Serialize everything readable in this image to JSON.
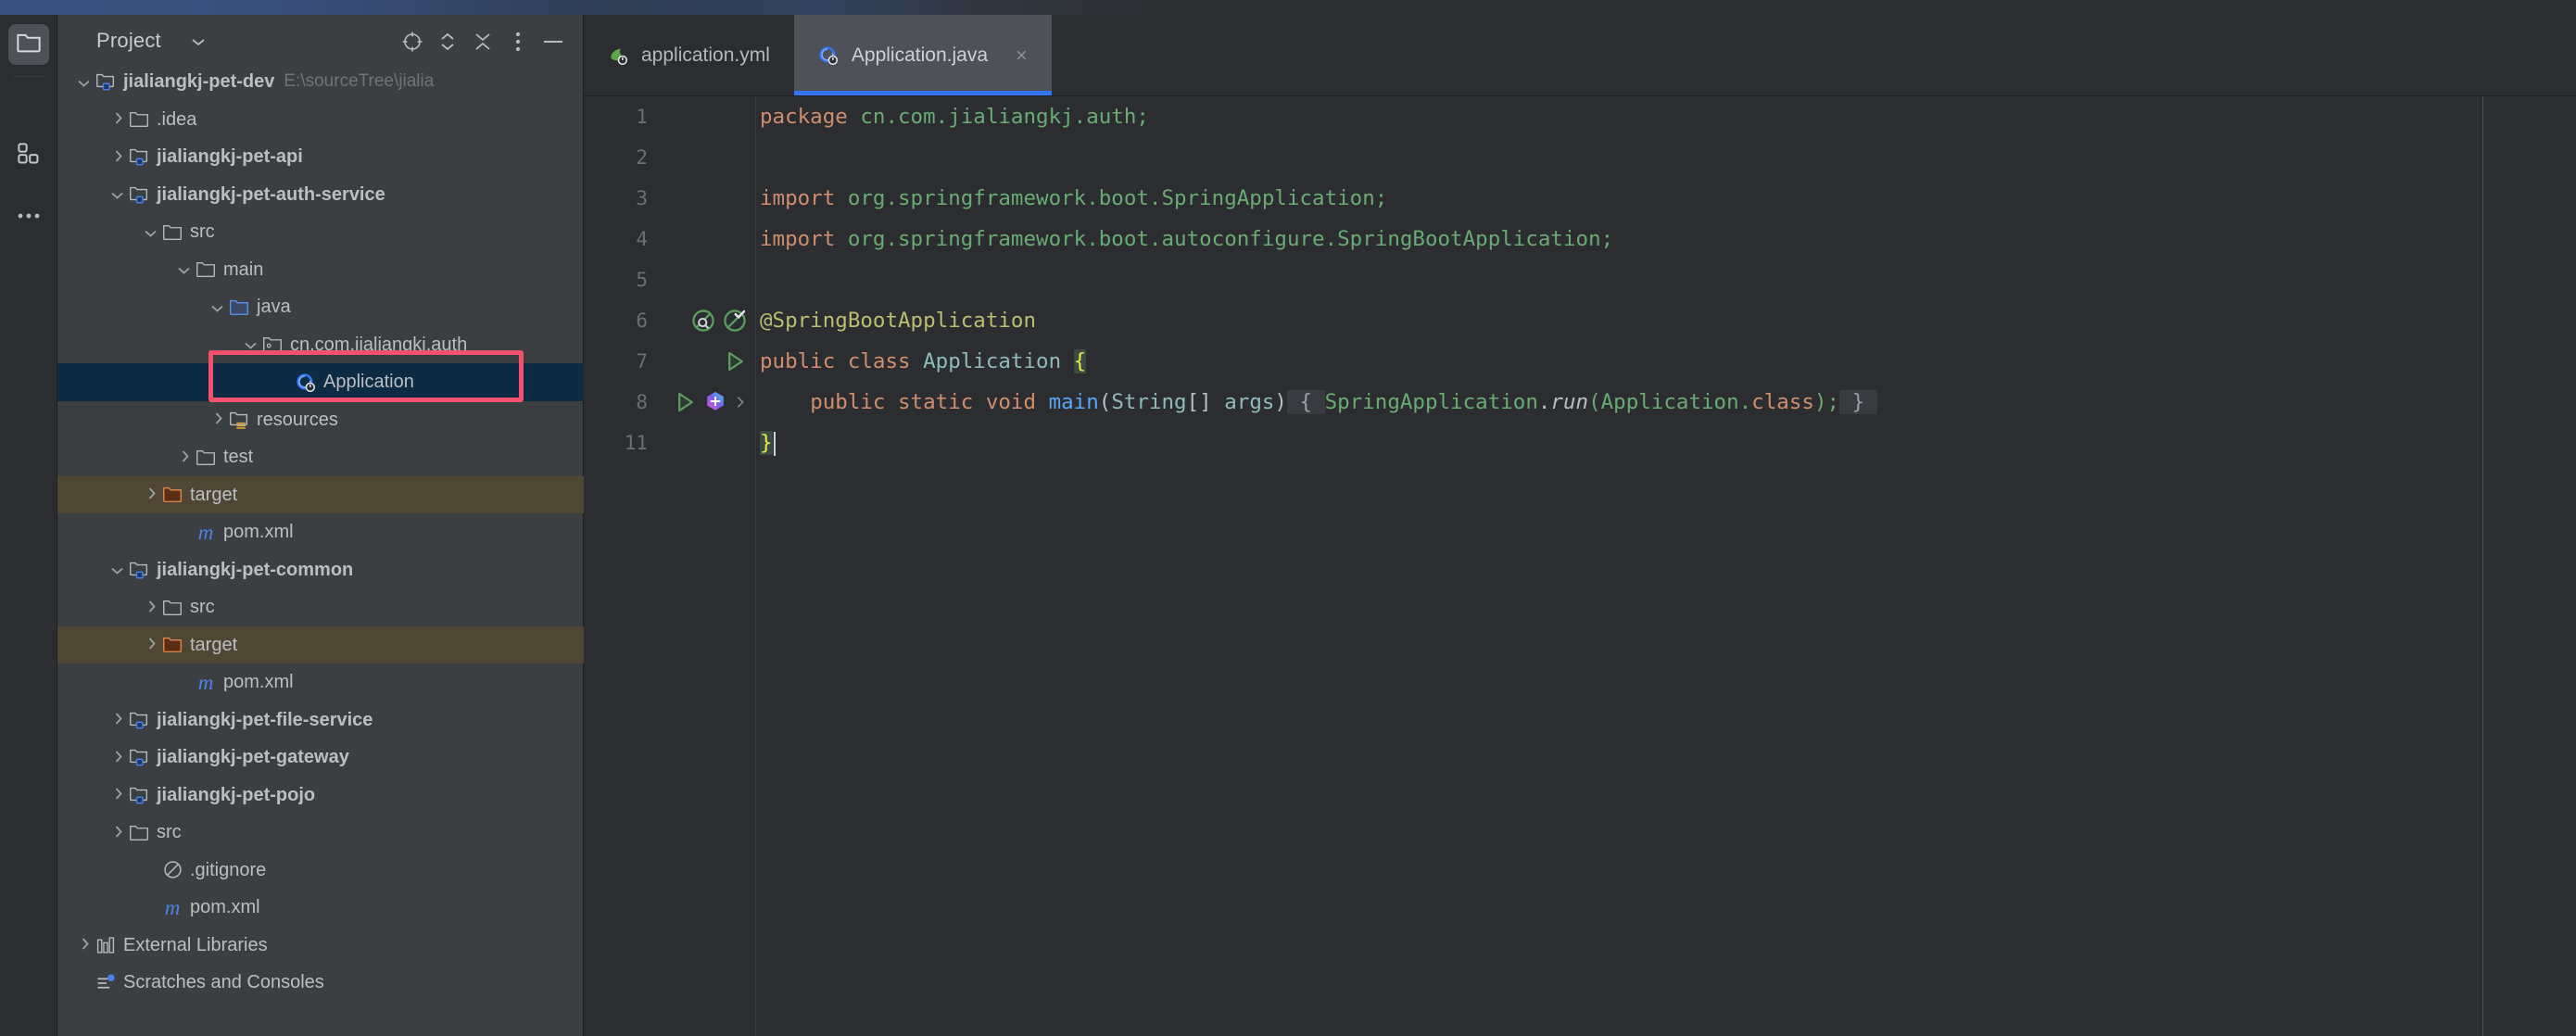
{
  "window": {
    "title_band_color": "#3b5280"
  },
  "activity_bar": {
    "items": [
      {
        "name": "project-folder",
        "icon": "folder-icon",
        "active": true
      },
      {
        "name": "structure",
        "icon": "grid-icon",
        "active": false
      },
      {
        "name": "more-tool-windows",
        "icon": "more-horizontal-icon",
        "active": false
      }
    ]
  },
  "tool_window": {
    "title": "Project",
    "dropdown_icon": "chevron-down-icon",
    "toolbar": [
      {
        "name": "select-opened-file",
        "icon": "crosshair-target-icon",
        "label": "Select Opened File"
      },
      {
        "name": "expand-collapse",
        "icon": "chevron-up-down-icon",
        "label": "Expand / Collapse"
      },
      {
        "name": "collapse-all",
        "icon": "collapse-all-icon",
        "label": "Collapse All"
      },
      {
        "name": "options-menu",
        "icon": "more-vertical-icon",
        "label": "Options"
      },
      {
        "name": "hide-tool-window",
        "icon": "minimize-icon",
        "label": "Hide"
      }
    ]
  },
  "tree": {
    "items": [
      {
        "label": "jialiangkj-pet-dev",
        "sub": "E:\\sourceTree\\jialia",
        "indent": 0,
        "arrow": "down",
        "icon": "module-folder-icon",
        "bold": true,
        "highlight": "none"
      },
      {
        "label": ".idea",
        "sub": "",
        "indent": 1,
        "arrow": "right",
        "icon": "folder-icon",
        "bold": false,
        "highlight": "none"
      },
      {
        "label": "jialiangkj-pet-api",
        "sub": "",
        "indent": 1,
        "arrow": "right",
        "icon": "module-folder-icon",
        "bold": true,
        "highlight": "none"
      },
      {
        "label": "jialiangkj-pet-auth-service",
        "sub": "",
        "indent": 1,
        "arrow": "down",
        "icon": "module-folder-icon",
        "bold": true,
        "highlight": "none"
      },
      {
        "label": "src",
        "sub": "",
        "indent": 2,
        "arrow": "down",
        "icon": "folder-icon",
        "bold": false,
        "highlight": "none"
      },
      {
        "label": "main",
        "sub": "",
        "indent": 3,
        "arrow": "down",
        "icon": "folder-icon",
        "bold": false,
        "highlight": "none"
      },
      {
        "label": "java",
        "sub": "",
        "indent": 4,
        "arrow": "down",
        "icon": "source-folder-icon",
        "bold": false,
        "highlight": "none"
      },
      {
        "label": "cn.com.jialiangkj.auth",
        "sub": "",
        "indent": 5,
        "arrow": "down",
        "icon": "package-icon",
        "bold": false,
        "highlight": "none"
      },
      {
        "label": "Application",
        "sub": "",
        "indent": 6,
        "arrow": "none",
        "icon": "spring-class-icon",
        "bold": false,
        "highlight": "selected"
      },
      {
        "label": "resources",
        "sub": "",
        "indent": 4,
        "arrow": "right",
        "icon": "resources-folder-icon",
        "bold": false,
        "highlight": "none"
      },
      {
        "label": "test",
        "sub": "",
        "indent": 3,
        "arrow": "right",
        "icon": "folder-icon",
        "bold": false,
        "highlight": "none"
      },
      {
        "label": "target",
        "sub": "",
        "indent": 2,
        "arrow": "right",
        "icon": "excluded-folder-icon",
        "bold": false,
        "highlight": "target"
      },
      {
        "label": "pom.xml",
        "sub": "",
        "indent": 3,
        "arrow": "none",
        "icon": "maven-icon",
        "bold": false,
        "highlight": "none"
      },
      {
        "label": "jialiangkj-pet-common",
        "sub": "",
        "indent": 1,
        "arrow": "down",
        "icon": "module-folder-icon",
        "bold": true,
        "highlight": "none"
      },
      {
        "label": "src",
        "sub": "",
        "indent": 2,
        "arrow": "right",
        "icon": "folder-icon",
        "bold": false,
        "highlight": "none"
      },
      {
        "label": "target",
        "sub": "",
        "indent": 2,
        "arrow": "right",
        "icon": "excluded-folder-icon",
        "bold": false,
        "highlight": "target"
      },
      {
        "label": "pom.xml",
        "sub": "",
        "indent": 3,
        "arrow": "none",
        "icon": "maven-icon",
        "bold": false,
        "highlight": "none"
      },
      {
        "label": "jialiangkj-pet-file-service",
        "sub": "",
        "indent": 1,
        "arrow": "right",
        "icon": "module-folder-icon",
        "bold": true,
        "highlight": "none"
      },
      {
        "label": "jialiangkj-pet-gateway",
        "sub": "",
        "indent": 1,
        "arrow": "right",
        "icon": "module-folder-icon",
        "bold": true,
        "highlight": "none"
      },
      {
        "label": "jialiangkj-pet-pojo",
        "sub": "",
        "indent": 1,
        "arrow": "right",
        "icon": "module-folder-icon",
        "bold": true,
        "highlight": "none"
      },
      {
        "label": "src",
        "sub": "",
        "indent": 1,
        "arrow": "right",
        "icon": "folder-icon",
        "bold": false,
        "highlight": "none"
      },
      {
        "label": ".gitignore",
        "sub": "",
        "indent": 2,
        "arrow": "none",
        "icon": "gitignore-icon",
        "bold": false,
        "highlight": "none"
      },
      {
        "label": "pom.xml",
        "sub": "",
        "indent": 2,
        "arrow": "none",
        "icon": "maven-icon",
        "bold": false,
        "highlight": "none"
      },
      {
        "label": "External Libraries",
        "sub": "",
        "indent": 0,
        "arrow": "right",
        "icon": "libraries-icon",
        "bold": false,
        "highlight": "none"
      },
      {
        "label": "Scratches and Consoles",
        "sub": "",
        "indent": 0,
        "arrow": "none",
        "icon": "scratches-icon",
        "bold": false,
        "highlight": "none"
      }
    ]
  },
  "editor": {
    "tabs": [
      {
        "label": "application.yml",
        "icon": "spring-yaml-icon",
        "active": false,
        "closable": false
      },
      {
        "label": "Application.java",
        "icon": "spring-class-icon",
        "active": true,
        "closable": true,
        "close_glyph": "×"
      }
    ],
    "accent_color": "#3574f0",
    "lines": [
      {
        "num": "1",
        "gutter_icons": []
      },
      {
        "num": "2",
        "gutter_icons": []
      },
      {
        "num": "3",
        "gutter_icons": []
      },
      {
        "num": "4",
        "gutter_icons": []
      },
      {
        "num": "5",
        "gutter_icons": []
      },
      {
        "num": "6",
        "gutter_icons": [
          "bean-search-icon",
          "bean-check-icon"
        ]
      },
      {
        "num": "7",
        "gutter_icons": [
          "run-icon"
        ]
      },
      {
        "num": "8",
        "gutter_icons": [
          "run-icon",
          "ai-assistant-icon",
          "chevron-right-icon"
        ]
      },
      {
        "num": "11",
        "gutter_icons": []
      }
    ],
    "code": {
      "l1_kw": "package",
      "l1_pkg": " cn.com.jialiangkj.auth;",
      "l3_kw": "import",
      "l3_rest": " org.springframework.boot.",
      "l3_cls": "SpringApplication",
      "l3_semi": ";",
      "l4_kw": "import",
      "l4_rest": " org.springframework.boot.autoconfigure.",
      "l4_cls": "SpringBootApplication",
      "l4_semi": ";",
      "l6_annotation": "@SpringBootApplication",
      "l7_kw1": "public",
      "l7_kw2": " class ",
      "l7_cls": "Application",
      "l7_brace": "{",
      "l8_indent": "    ",
      "l8_kw": "public static void ",
      "l8_method": "main",
      "l8_paren1": "(",
      "l8_type": "String",
      "l8_brackets": "[] ",
      "l8_arg": "args",
      "l8_paren2": ")",
      "l8_fold_open": " { ",
      "l8_fold_cls": "SpringApplication",
      "l8_fold_dot": ".",
      "l8_fold_run": "run",
      "l8_fold_p1": "(",
      "l8_fold_app": "Application",
      "l8_fold_dot2": ".",
      "l8_fold_class": "class",
      "l8_fold_end": ");",
      "l8_fold_close": " } ",
      "l11_brace": "}"
    }
  },
  "annotation": {
    "box_color": "#f4516c",
    "target": "cn.com.jialiangkj.auth package and Application class"
  }
}
